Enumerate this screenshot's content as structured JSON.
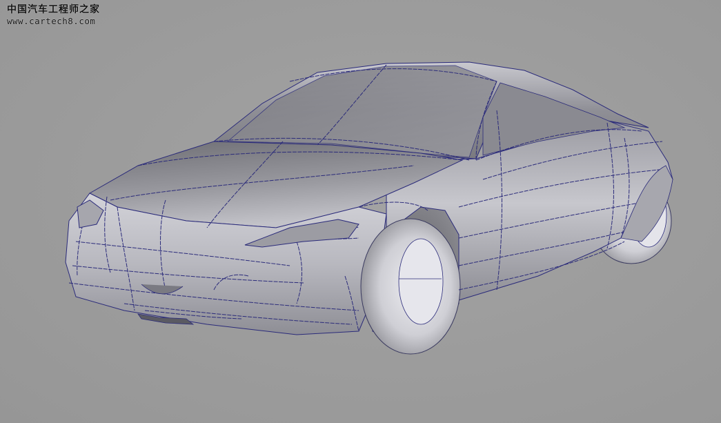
{
  "watermark": {
    "title": "中国汽车工程师之家",
    "url": "www.cartech8.com"
  },
  "colors": {
    "background": "#9d9d9d",
    "body_surface": "#b8b8be",
    "curve_lines": "#2a2a7a",
    "tire": "#d8d8dc"
  }
}
